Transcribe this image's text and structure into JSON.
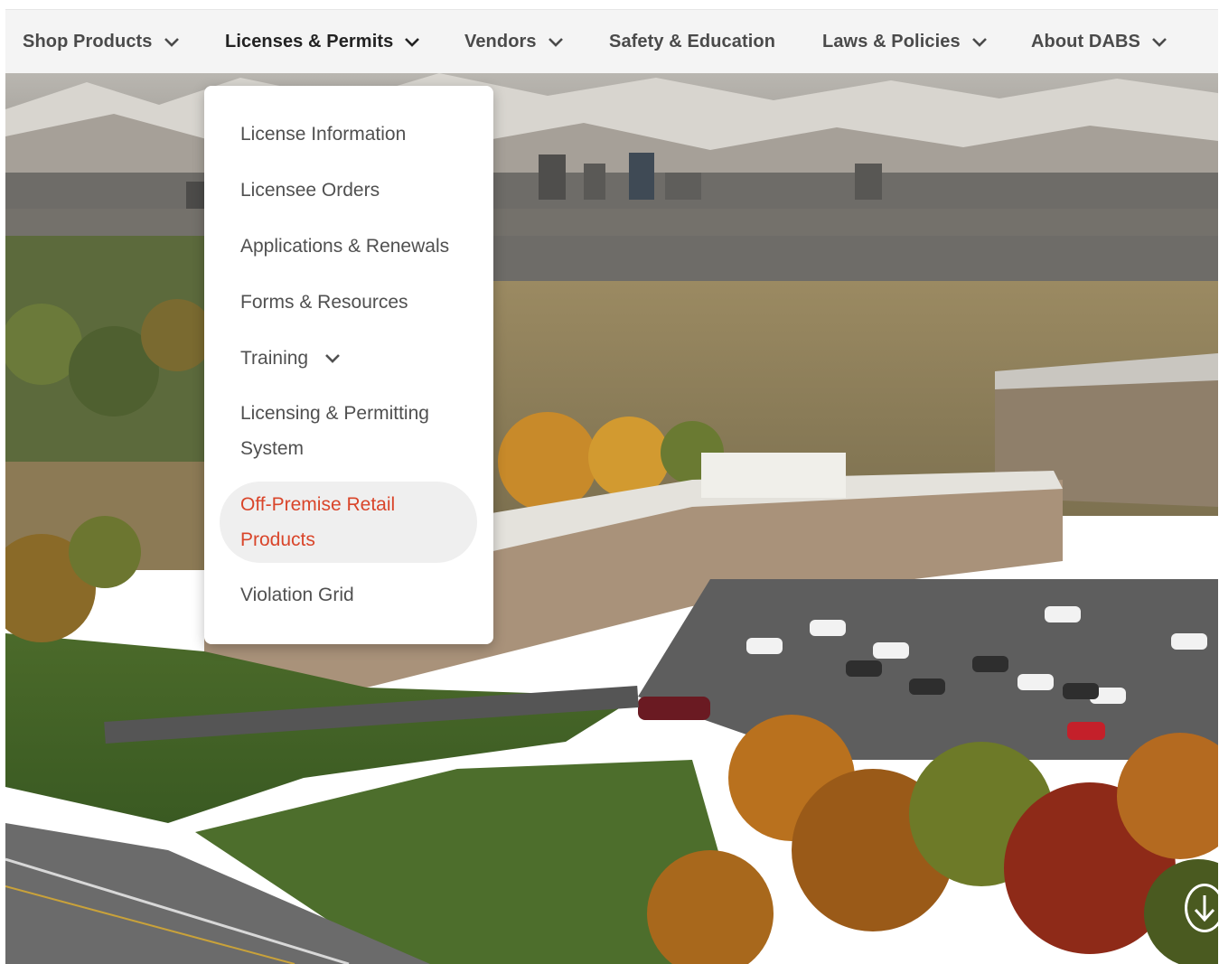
{
  "nav": {
    "items": [
      {
        "label": "Shop Products",
        "has_dropdown": true
      },
      {
        "label": "Licenses & Permits",
        "has_dropdown": true,
        "active": true
      },
      {
        "label": "Vendors",
        "has_dropdown": true
      },
      {
        "label": "Safety & Education",
        "has_dropdown": false
      },
      {
        "label": "Laws & Policies",
        "has_dropdown": true
      },
      {
        "label": "About DABS",
        "has_dropdown": true
      }
    ]
  },
  "dropdown": {
    "items": [
      {
        "label": "License Information"
      },
      {
        "label": "Licensee Orders"
      },
      {
        "label": "Applications & Renewals"
      },
      {
        "label": "Forms & Resources"
      },
      {
        "label": "Training",
        "has_submenu": true
      },
      {
        "label_line1": "Licensing & Permitting",
        "label_line2": "System"
      },
      {
        "label_line1": "Off-Premise Retail",
        "label_line2": "Products",
        "highlighted": true
      },
      {
        "label": "Violation Grid"
      }
    ]
  },
  "icons": {
    "chevron": "chevron-down-icon",
    "scroll": "arrow-down-circle-icon"
  },
  "colors": {
    "nav_bg": "#f4f4f4",
    "nav_text": "#4a4a4a",
    "highlight_text": "#d9452a",
    "highlight_bg": "#efefef"
  }
}
